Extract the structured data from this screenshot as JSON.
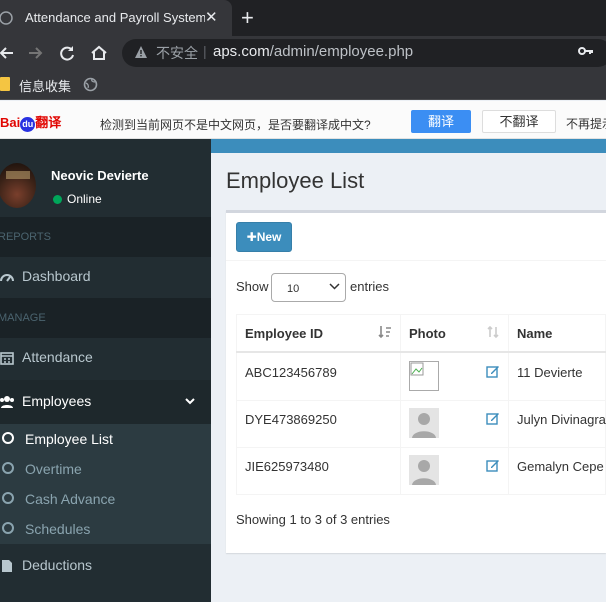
{
  "browser": {
    "tab_title": "Attendance and Payroll System",
    "insecure_label": "不安全",
    "url_host": "aps.com",
    "url_path": "/admin/employee.php",
    "bookmark_folder": "信息收集"
  },
  "translate_bar": {
    "logo_bai": "Bai",
    "logo_du": "du",
    "logo_text": "翻译",
    "message": "检测到当前网页不是中文网页，是否要翻译成中文?",
    "translate_button": "翻译",
    "no_translate_button": "不翻译",
    "never_prompt": "不再提示"
  },
  "sidebar": {
    "user_name": "Neovic Devierte",
    "status": "Online",
    "header_reports": "REPORTS",
    "header_manage": "MANAGE",
    "items": {
      "dashboard": "Dashboard",
      "attendance": "Attendance",
      "employees": "Employees",
      "deductions": "Deductions"
    },
    "subitems": [
      "Employee List",
      "Overtime",
      "Cash Advance",
      "Schedules"
    ]
  },
  "main": {
    "page_title": "Employee List",
    "new_button": "New",
    "show_label": "Show",
    "entries_label": "entries",
    "page_length": "10",
    "columns": [
      "Employee ID",
      "Photo",
      "Name"
    ],
    "rows": [
      {
        "id": "ABC123456789",
        "name": "11 Devierte",
        "photo": "broken"
      },
      {
        "id": "DYE473869250",
        "name": "Julyn Divinagracia",
        "photo": "placeholder"
      },
      {
        "id": "JIE625973480",
        "name": "Gemalyn Cepe",
        "photo": "placeholder"
      }
    ],
    "info": "Showing 1 to 3 of 3 entries"
  },
  "colors": {
    "sidebar_bg": "#222d32",
    "accent": "#3c8dbc",
    "online": "#00a65a"
  }
}
